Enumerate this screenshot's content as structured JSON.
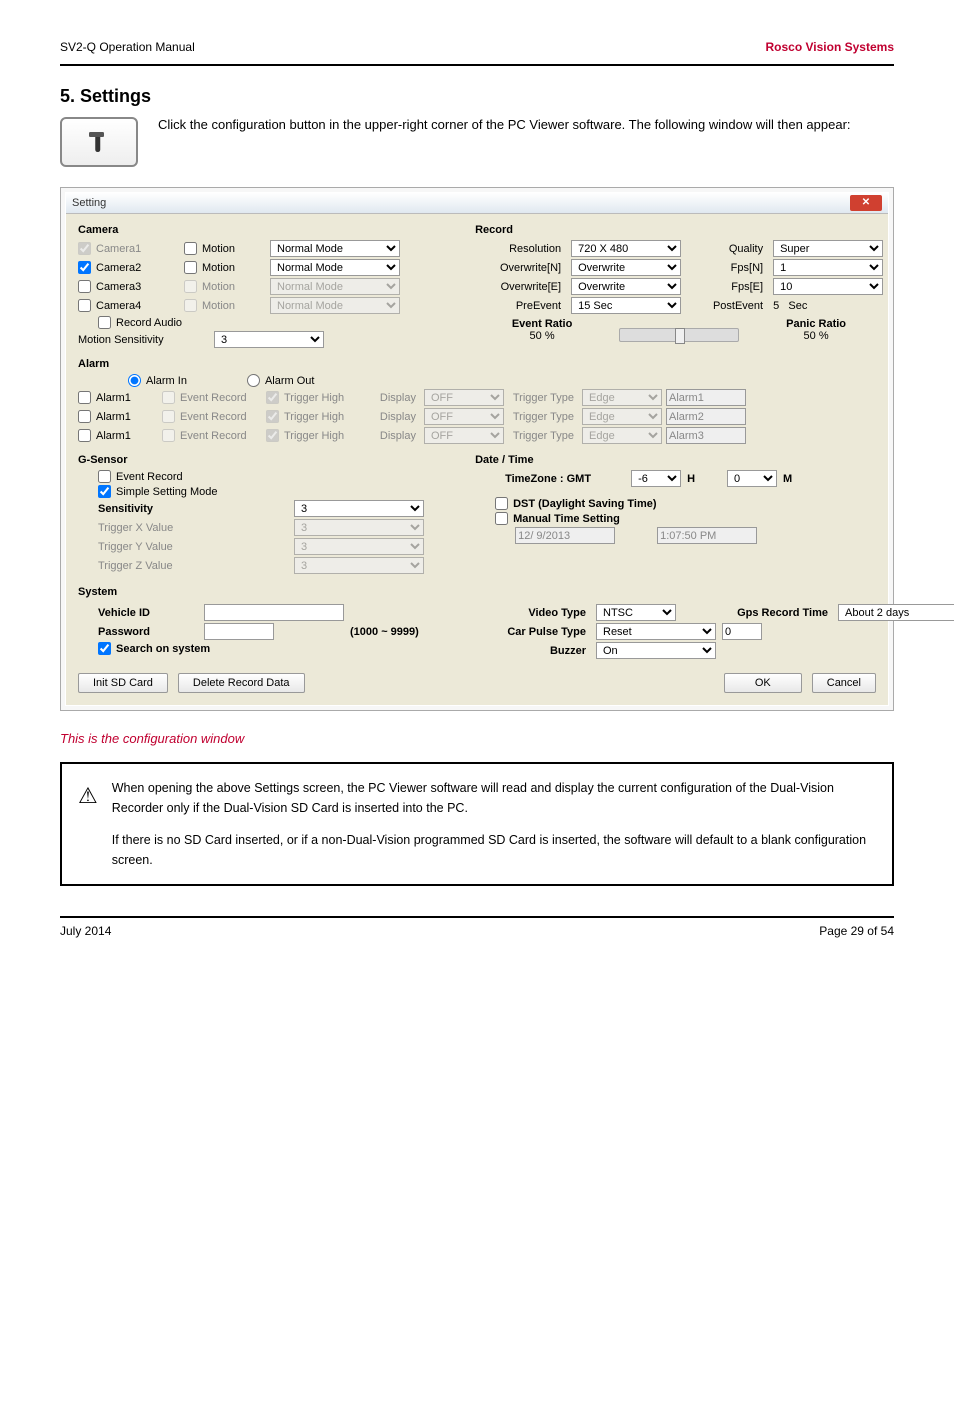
{
  "header": {
    "left": "SV2-Q Operation Manual",
    "right": "Rosco Vision Systems"
  },
  "section_title": "5. Settings",
  "intro": "Click the configuration button in the upper-right corner of the PC Viewer software. The following window will then appear:",
  "window": {
    "title": "Setting",
    "groups": {
      "camera": "Camera",
      "record": "Record",
      "alarm": "Alarm",
      "gsensor": "G-Sensor",
      "datetime": "Date / Time",
      "system": "System"
    },
    "camera": {
      "rows": [
        {
          "name": "Camera1",
          "checked": true,
          "cam_disabled": true,
          "motion_label": "Motion",
          "motion_checked": false,
          "mode": "Normal Mode",
          "mode_disabled": false
        },
        {
          "name": "Camera2",
          "checked": true,
          "cam_disabled": false,
          "motion_label": "Motion",
          "motion_checked": false,
          "mode": "Normal Mode",
          "mode_disabled": false
        },
        {
          "name": "Camera3",
          "checked": false,
          "cam_disabled": false,
          "motion_label": "Motion",
          "motion_checked": false,
          "mode": "Normal Mode",
          "mode_disabled": true
        },
        {
          "name": "Camera4",
          "checked": false,
          "cam_disabled": false,
          "motion_label": "Motion",
          "motion_checked": false,
          "mode": "Normal Mode",
          "mode_disabled": true
        }
      ],
      "record_audio": "Record Audio",
      "motion_sensitivity_label": "Motion Sensitivity",
      "motion_sensitivity_value": "3"
    },
    "record": {
      "resolution_label": "Resolution",
      "resolution_value": "720 X 480",
      "quality_label": "Quality",
      "quality_value": "Super",
      "overwrite_n_label": "Overwrite[N]",
      "overwrite_n_value": "Overwrite",
      "fps_n_label": "Fps[N]",
      "fps_n_value": "1",
      "overwrite_e_label": "Overwrite[E]",
      "overwrite_e_value": "Overwrite",
      "fps_e_label": "Fps[E]",
      "fps_e_value": "10",
      "preevent_label": "PreEvent",
      "preevent_value": "15 Sec",
      "postevent_label": "PostEvent",
      "postevent_value": "5",
      "postevent_unit": "Sec",
      "event_ratio_label": "Event Ratio",
      "event_ratio_value": "50 %",
      "panic_ratio_label": "Panic Ratio",
      "panic_ratio_value": "50 %"
    },
    "alarm": {
      "in_label": "Alarm In",
      "out_label": "Alarm Out",
      "display_label": "Display",
      "trigger_type_label": "Trigger Type",
      "rows": [
        {
          "name": "Alarm1",
          "event_record": "Event Record",
          "trigger_high": "Trigger High",
          "display_value": "OFF",
          "trigger_type_value": "Edge",
          "out_label": "Alarm1"
        },
        {
          "name": "Alarm1",
          "event_record": "Event Record",
          "trigger_high": "Trigger High",
          "display_value": "OFF",
          "trigger_type_value": "Edge",
          "out_label": "Alarm2"
        },
        {
          "name": "Alarm1",
          "event_record": "Event Record",
          "trigger_high": "Trigger High",
          "display_value": "OFF",
          "trigger_type_value": "Edge",
          "out_label": "Alarm3"
        }
      ]
    },
    "gsensor": {
      "event_record": "Event Record",
      "simple_mode": "Simple Setting Mode",
      "sensitivity_label": "Sensitivity",
      "sensitivity_value": "3",
      "trig_x_label": "Trigger X Value",
      "trig_x_value": "3",
      "trig_y_label": "Trigger Y Value",
      "trig_y_value": "3",
      "trig_z_label": "Trigger Z Value",
      "trig_z_value": "3"
    },
    "datetime": {
      "timezone_label": "TimeZone : GMT",
      "h_value": "-6",
      "h_unit": "H",
      "m_value": "0",
      "m_unit": "M",
      "dst_label": "DST (Daylight Saving Time)",
      "manual_label": "Manual Time Setting",
      "date_value": "12/ 9/2013",
      "time_value": "1:07:50 PM"
    },
    "system": {
      "vehicle_id_label": "Vehicle ID",
      "password_label": "Password",
      "password_hint": "(1000 ~ 9999)",
      "search_label": "Search on system",
      "video_type_label": "Video Type",
      "video_type_value": "NTSC",
      "car_pulse_label": "Car Pulse Type",
      "car_pulse_value": "Reset",
      "car_pulse_num": "0",
      "buzzer_label": "Buzzer",
      "buzzer_value": "On",
      "gps_label": "Gps Record Time",
      "gps_value": "About 2 days"
    },
    "buttons": {
      "init_sd": "Init SD Card",
      "delete_record": "Delete Record Data",
      "ok": "OK",
      "cancel": "Cancel"
    }
  },
  "caption": "This is the configuration window",
  "note": {
    "line1": "When opening the above Settings screen, the PC Viewer software will read and display the current configuration of the Dual-Vision Recorder only if the Dual-Vision SD Card is inserted into the PC.",
    "line2": "If there is no SD Card inserted, or if a non-Dual-Vision programmed SD Card is inserted, the software will default to a blank configuration screen."
  },
  "footer": {
    "left": "July 2014",
    "right": "Page 29 of 54"
  }
}
